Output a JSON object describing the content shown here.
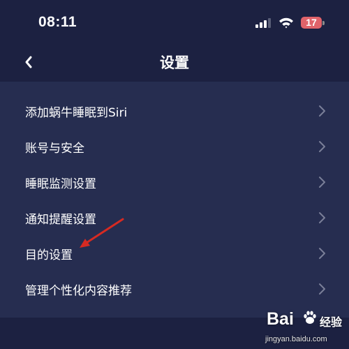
{
  "status_bar": {
    "time": "08:11",
    "battery_level": "17",
    "battery_color": "#e0636a",
    "icons": [
      "cellular-signal-icon",
      "wifi-icon",
      "battery-icon"
    ]
  },
  "nav": {
    "title": "设置",
    "back_icon": "chevron-left-icon"
  },
  "settings": {
    "items": [
      {
        "label": "添加蜗牛睡眠到Siri"
      },
      {
        "label": "账号与安全"
      },
      {
        "label": "睡眠监测设置"
      },
      {
        "label": "通知提醒设置"
      },
      {
        "label": "目的设置"
      },
      {
        "label": "管理个性化内容推荐"
      }
    ]
  },
  "annotation": {
    "arrow_color": "#d62a22"
  },
  "watermark": {
    "logo": "Bai  ",
    "text": "经验",
    "url": "jingyan.baidu.com"
  }
}
